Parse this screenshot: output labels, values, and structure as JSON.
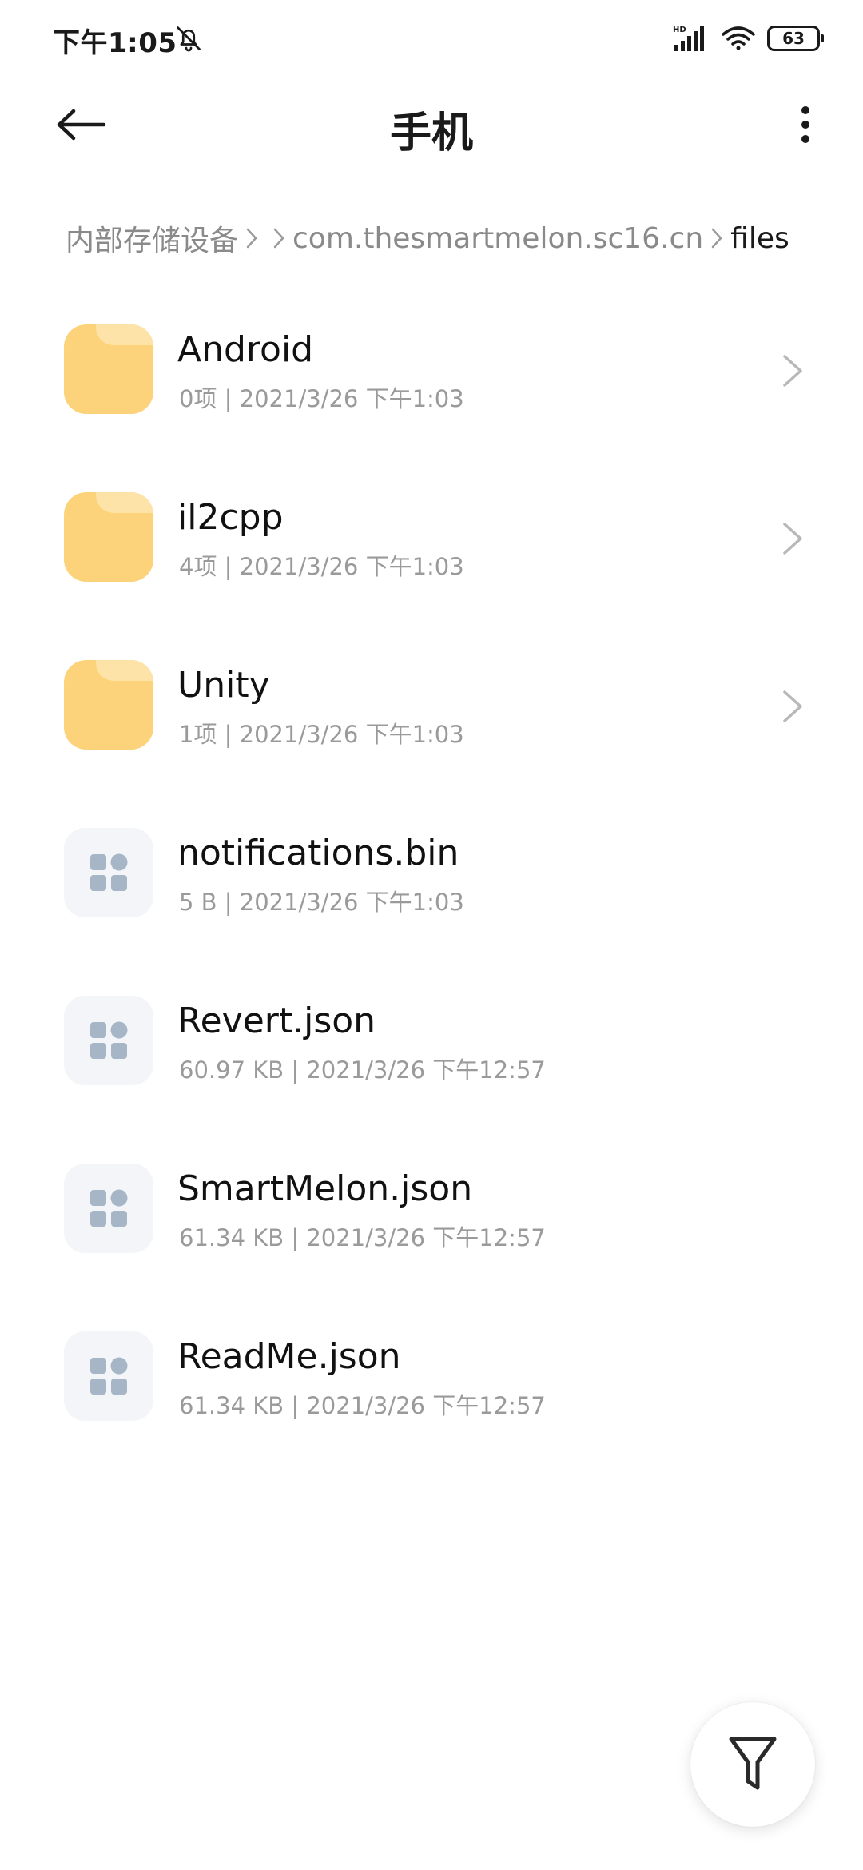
{
  "status_bar": {
    "time": "下午1:05",
    "mute_icon": "bell-off-icon",
    "network_badge": "HD",
    "battery_level": "63"
  },
  "header": {
    "title": "手机",
    "back_icon": "arrow-left-icon",
    "more_icon": "more-vertical-icon"
  },
  "breadcrumb": {
    "items": [
      "内部存储设备",
      "com.thesmartmelon.sc16.cn",
      "files"
    ]
  },
  "files": [
    {
      "name": "Android",
      "meta": "0项  |  2021/3/26 下午1:03",
      "type": "folder"
    },
    {
      "name": "il2cpp",
      "meta": "4项  |  2021/3/26 下午1:03",
      "type": "folder"
    },
    {
      "name": "Unity",
      "meta": "1项  |  2021/3/26 下午1:03",
      "type": "folder"
    },
    {
      "name": "notifications.bin",
      "meta": "5 B  |  2021/3/26 下午1:03",
      "type": "file"
    },
    {
      "name": "Revert.json",
      "meta": "60.97 KB  |  2021/3/26 下午12:57",
      "type": "file"
    },
    {
      "name": "SmartMelon.json",
      "meta": "61.34 KB  |  2021/3/26 下午12:57",
      "type": "file"
    },
    {
      "name": "ReadMe.json",
      "meta": "61.34 KB  |  2021/3/26 下午12:57",
      "type": "file"
    }
  ],
  "fab": {
    "icon": "filter-icon"
  },
  "colors": {
    "folder": "#fcd37b",
    "file_tile": "#f3f5f8",
    "file_glyph": "#a7b6c6",
    "secondary_text": "#9a9a9a"
  }
}
